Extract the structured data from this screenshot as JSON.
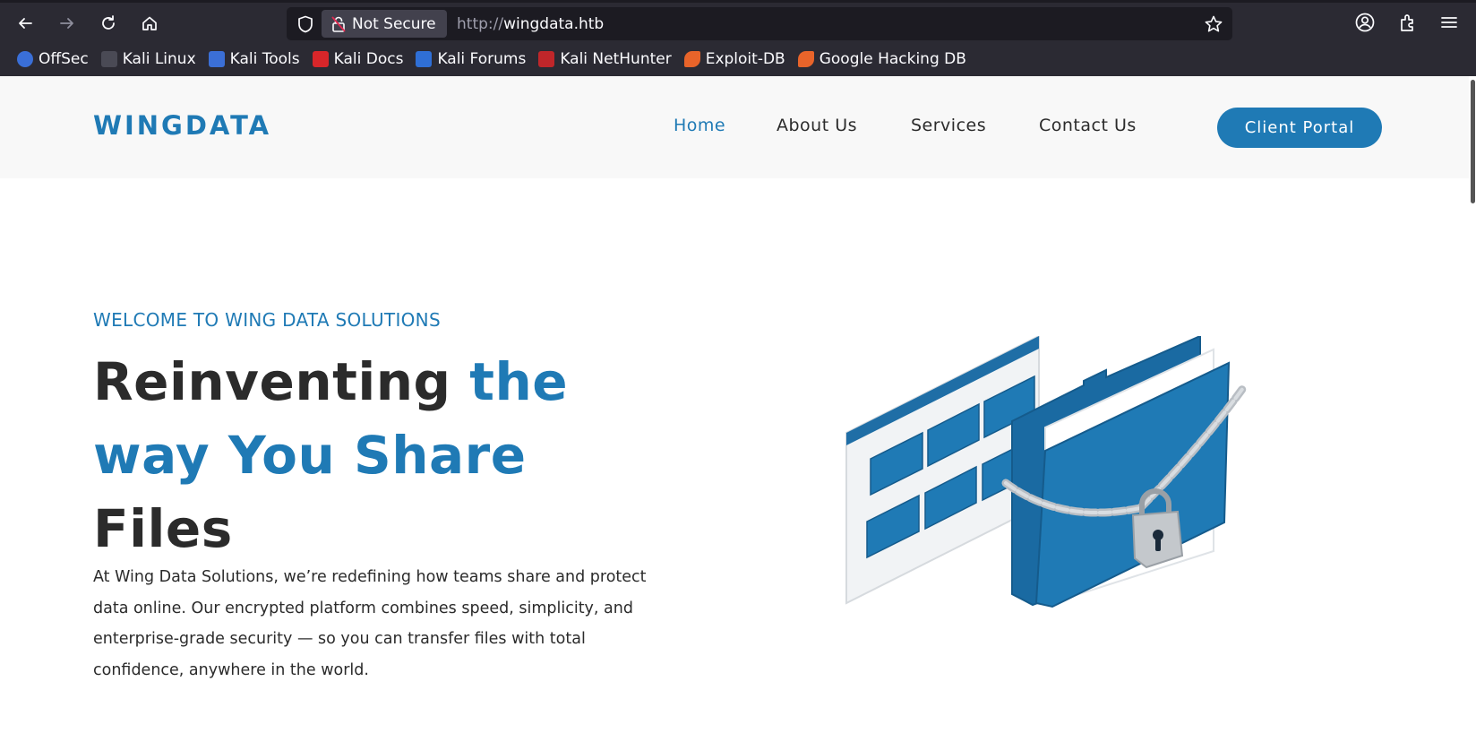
{
  "browser": {
    "security_label": "Not Secure",
    "url_scheme": "http://",
    "url_host": "wingdata.htb",
    "bookmarks": [
      {
        "label": "OffSec",
        "color": "#3a6fd8"
      },
      {
        "label": "Kali Linux",
        "color": "#1c1b22"
      },
      {
        "label": "Kali Tools",
        "color": "#d84a6a"
      },
      {
        "label": "Kali Docs",
        "color": "#d8262a"
      },
      {
        "label": "Kali Forums",
        "color": "#2f6fd6"
      },
      {
        "label": "Kali NetHunter",
        "color": "#c0262a"
      },
      {
        "label": "Exploit-DB",
        "color": "#e8642a"
      },
      {
        "label": "Google Hacking DB",
        "color": "#e8642a"
      }
    ]
  },
  "site": {
    "logo": "WINGDATA",
    "nav": {
      "home": "Home",
      "about": "About Us",
      "services": "Services",
      "contact": "Contact Us"
    },
    "portal_button": "Client Portal",
    "accent_color": "#1f7ab5"
  },
  "hero": {
    "eyebrow": "WELCOME TO WING DATA SOLUTIONS",
    "headline_part1": "Reinventing ",
    "headline_highlight": "the way You Share",
    "headline_part2": "Files",
    "lead": "At Wing Data Solutions, we’re redefining how teams share and protect data online. Our encrypted platform combines speed, simplicity, and enterprise-grade security — so you can transfer files with total confidence, anywhere in the world."
  }
}
